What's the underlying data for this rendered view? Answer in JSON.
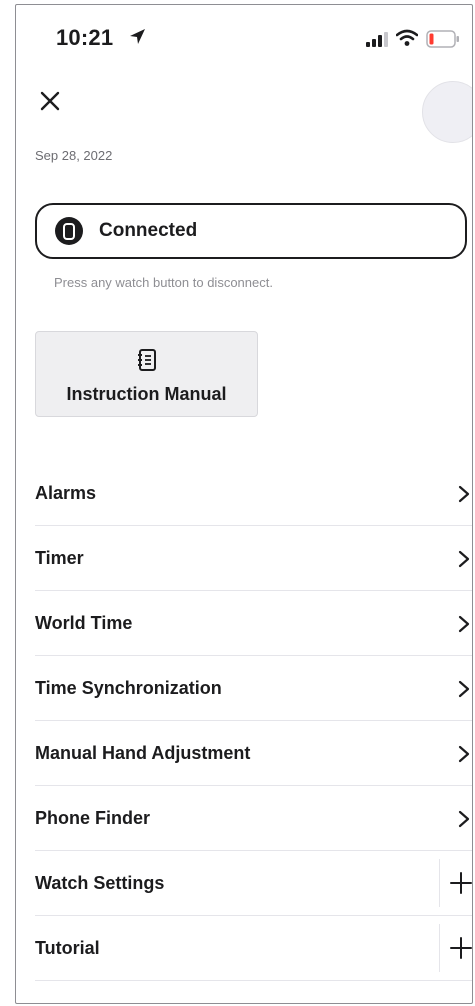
{
  "status_bar": {
    "time": "10:21",
    "location_icon": "location-arrow-icon",
    "signal_icon": "cellular-signal-icon",
    "wifi_icon": "wifi-icon",
    "battery_icon": "battery-low-icon",
    "battery_color": "#ff3b30"
  },
  "header": {
    "close_icon": "close-icon",
    "date": "Sep 28, 2022"
  },
  "connection": {
    "status_label": "Connected",
    "hint": "Press any watch button to disconnect."
  },
  "manual": {
    "label": "Instruction Manual",
    "icon": "notebook-icon"
  },
  "menu": [
    {
      "label": "Alarms",
      "icon": "chevron-right-icon"
    },
    {
      "label": "Timer",
      "icon": "chevron-right-icon"
    },
    {
      "label": "World Time",
      "icon": "chevron-right-icon"
    },
    {
      "label": "Time Synchronization",
      "icon": "chevron-right-icon"
    },
    {
      "label": "Manual Hand Adjustment",
      "icon": "chevron-right-icon"
    },
    {
      "label": "Phone Finder",
      "icon": "chevron-right-icon"
    },
    {
      "label": "Watch Settings",
      "icon": "plus-icon"
    },
    {
      "label": "Tutorial",
      "icon": "plus-icon"
    }
  ],
  "colors": {
    "text": "#1c1c1e",
    "muted": "#6d6d72",
    "card_bg": "#efeff1",
    "separator": "#e5e5ea"
  }
}
